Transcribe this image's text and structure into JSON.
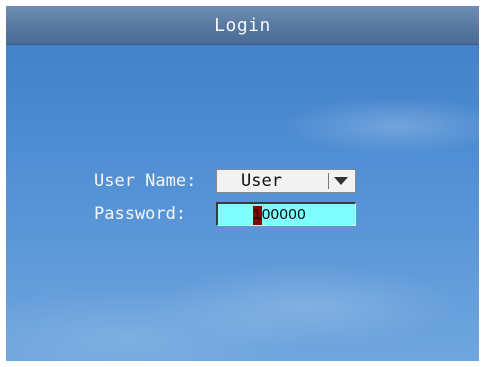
{
  "window": {
    "title": "Login"
  },
  "form": {
    "username_label": "User Name:",
    "username_value": "User",
    "password_label": "Password:",
    "password_value": "100000"
  },
  "icons": {
    "dropdown": "chevron-down-icon"
  },
  "colors": {
    "password_field_bg": "#7fffff",
    "cursor": "#8b0000",
    "title_bar": "#5878a0"
  }
}
